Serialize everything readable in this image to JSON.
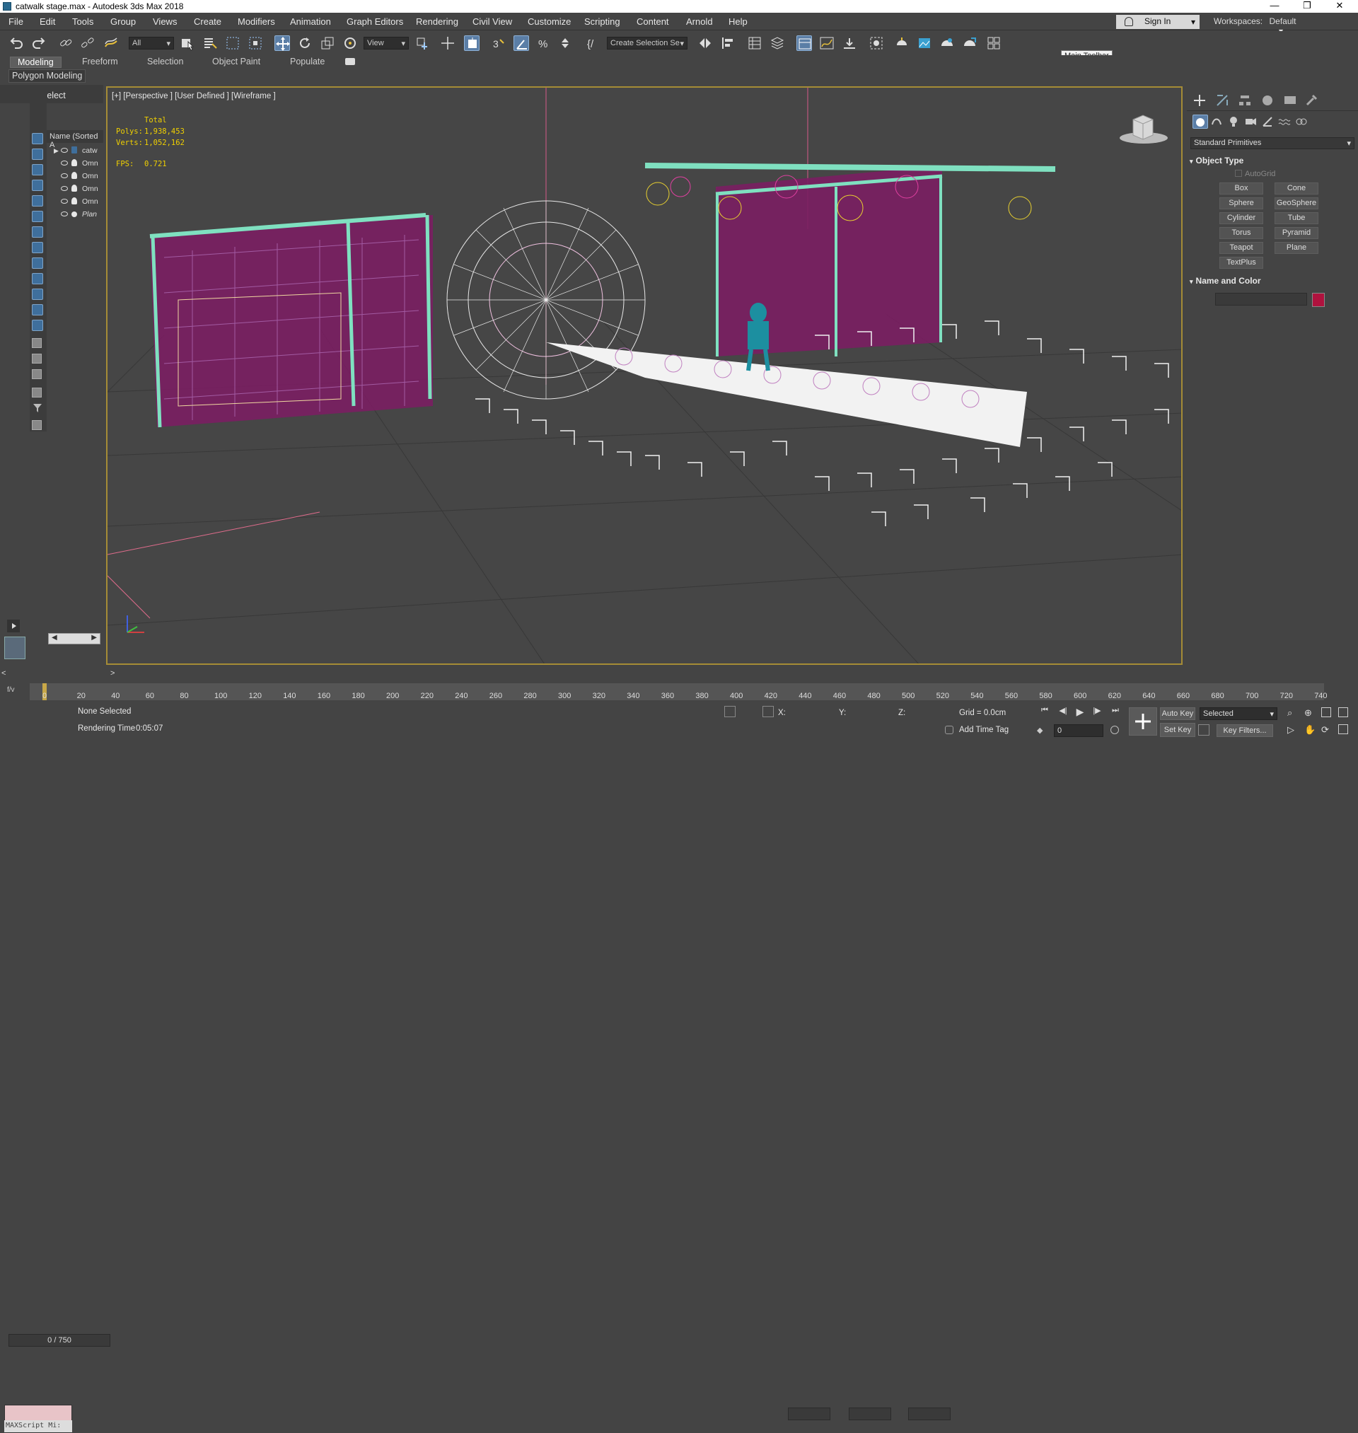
{
  "window": {
    "title": "catwalk stage.max - Autodesk 3ds Max 2018",
    "minimize": "—",
    "restore": "❐",
    "close": "✕"
  },
  "menu": [
    "File",
    "Edit",
    "Tools",
    "Group",
    "Views",
    "Create",
    "Modifiers",
    "Animation",
    "Graph Editors",
    "Rendering",
    "Civil View",
    "Customize",
    "Scripting",
    "Content",
    "Arnold",
    "Help"
  ],
  "signin": {
    "label": "Sign In"
  },
  "workspaces": {
    "label": "Workspaces:",
    "value": "Default"
  },
  "toolbar": {
    "filter": "All",
    "refcoord": "View",
    "selset": "Create Selection Se"
  },
  "tooltip": "Main Toolbar",
  "ribbon": {
    "tabs": [
      "Modeling",
      "Freeform",
      "Selection",
      "Object Paint",
      "Populate"
    ],
    "sub": "Polygon Modeling"
  },
  "scene_explorer": {
    "title": "Select",
    "column": "Name (Sorted A",
    "rows": [
      "catw",
      "Omn",
      "Omn",
      "Omn",
      "Omn",
      "Plan"
    ]
  },
  "viewport": {
    "label": "[+] [Perspective ] [User Defined ] [Wireframe ]",
    "stats": {
      "header": "Total",
      "polys_label": "Polys:",
      "polys": "1,938,453",
      "verts_label": "Verts:",
      "verts": "1,052,162",
      "fps_label": "FPS:",
      "fps": "0.721"
    }
  },
  "command_panel": {
    "dropdown": "Standard Primitives",
    "object_type": "Object Type",
    "autogrid": "AutoGrid",
    "buttons": [
      "Box",
      "Cone",
      "Sphere",
      "GeoSphere",
      "Cylinder",
      "Tube",
      "Torus",
      "Pyramid",
      "Teapot",
      "Plane",
      "TextPlus"
    ],
    "name_color": "Name and Color",
    "swatch_color": "#b0123e"
  },
  "timeline": {
    "slider": "0 / 750",
    "ticks": [
      "0",
      "20",
      "40",
      "60",
      "80",
      "100",
      "120",
      "140",
      "160",
      "180",
      "200",
      "220",
      "240",
      "260",
      "280",
      "300",
      "320",
      "340",
      "360",
      "380",
      "400",
      "420",
      "440",
      "460",
      "480",
      "500",
      "520",
      "540",
      "560",
      "580",
      "600",
      "620",
      "640",
      "660",
      "680",
      "700",
      "720",
      "740"
    ]
  },
  "status": {
    "maxscript": "MAXScript Mi:",
    "selection": "None Selected",
    "render_label": "Rendering Time",
    "render_time": "0:05:07",
    "x": "X:",
    "y": "Y:",
    "z": "Z:",
    "grid": "Grid = 0.0cm",
    "add_time_tag": "Add Time Tag",
    "auto_key": "Auto Key",
    "selected": "Selected",
    "set_key": "Set Key",
    "key_filters": "Key Filters...",
    "frame": "0"
  }
}
